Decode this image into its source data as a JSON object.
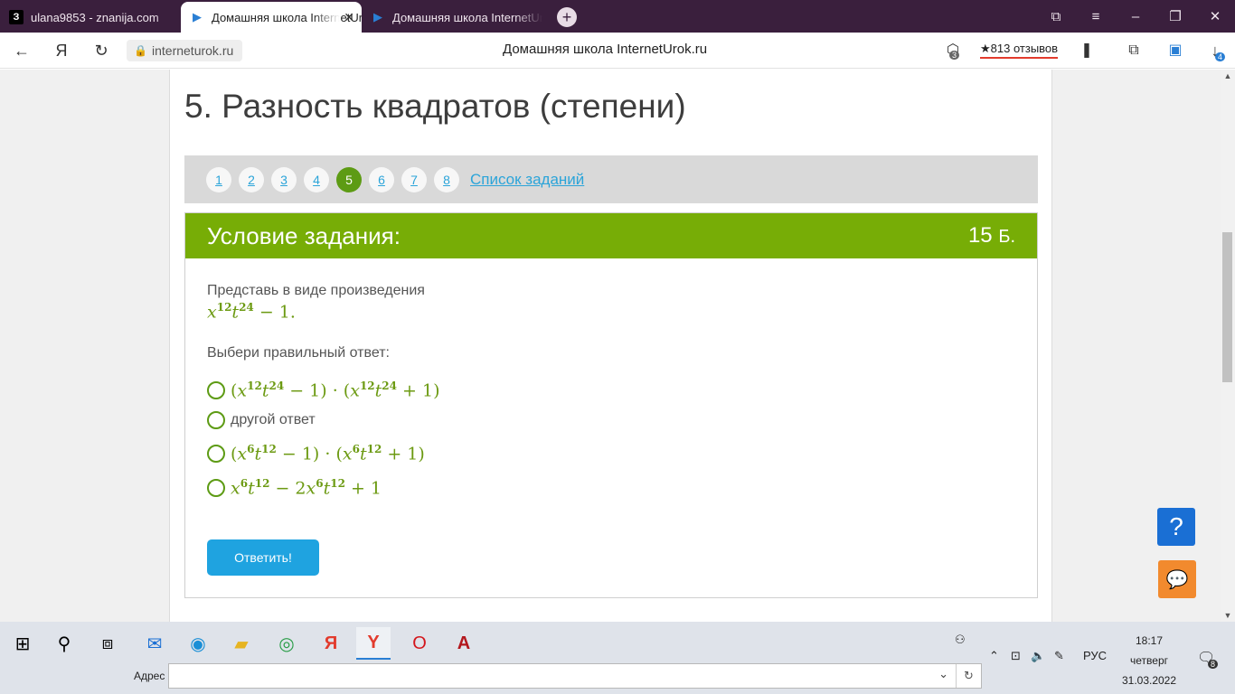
{
  "tabs": [
    {
      "label": "ulana9853 - znanija.com",
      "icon": "znanija-icon"
    },
    {
      "label": "Домашняя школа InternetUrok.ru",
      "icon": "play-icon"
    },
    {
      "label": "Домашняя школа InternetUrok.ru",
      "icon": "play-icon"
    }
  ],
  "address": {
    "url": "interneturok.ru",
    "page_title": "Домашняя школа InternetUrok.ru",
    "reviews": "★813 отзывов",
    "tabs_badge": "3",
    "downloads_badge": "4"
  },
  "page": {
    "title": "5. Разность квадратов (степени)",
    "numbers": [
      "1",
      "2",
      "3",
      "4",
      "5",
      "6",
      "7",
      "8"
    ],
    "current_number": "5",
    "task_list": "Список заданий",
    "task_header": "Условие задания:",
    "points_value": "15",
    "points_unit": "Б.",
    "condition": "Представь в виде произведения",
    "choose": "Выбери правильный ответ:",
    "other_answer": "другой ответ",
    "submit": "Ответить!",
    "help": "?"
  },
  "taskbar": {
    "address_label": "Адрес",
    "lang": "РУС",
    "time": "18:17",
    "day": "четверг",
    "date": "31.03.2022",
    "notif_count": "8"
  },
  "colors": {
    "accent_green": "#77ad06",
    "link_blue": "#2ba4d9",
    "button_blue": "#1fa3e0",
    "tab_bar": "#3a1f3d"
  }
}
